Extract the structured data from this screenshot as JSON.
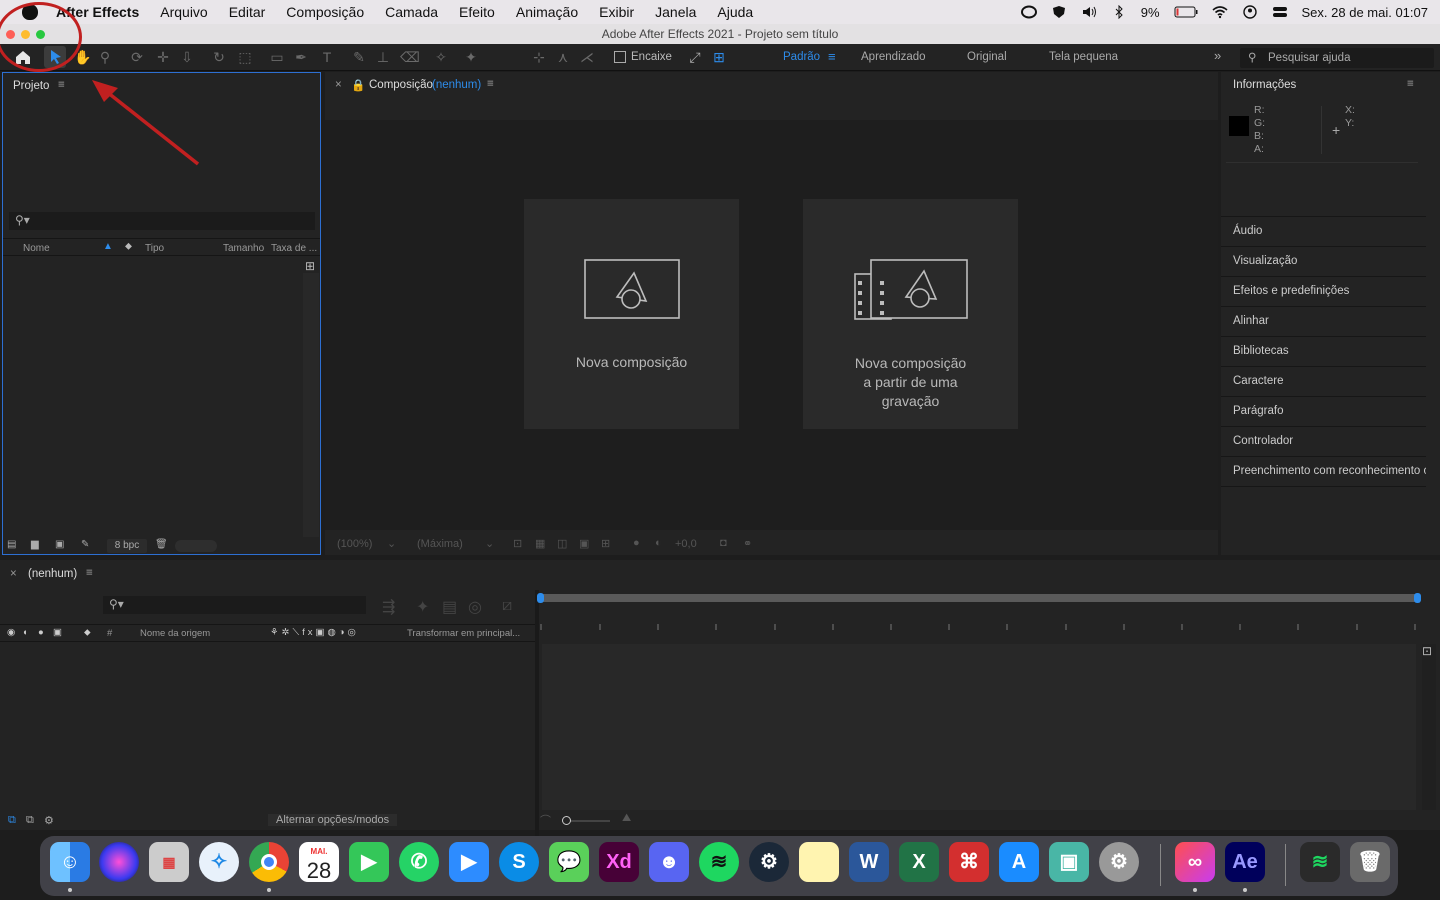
{
  "menubar": {
    "app_name": "After Effects",
    "items": [
      "Arquivo",
      "Editar",
      "Composição",
      "Camada",
      "Efeito",
      "Animação",
      "Exibir",
      "Janela",
      "Ajuda"
    ],
    "battery": "9%",
    "datetime": "Sex. 28 de mai.  01:07"
  },
  "window": {
    "title": "Adobe After Effects 2021 - Projeto sem título"
  },
  "toolbar": {
    "snap_label": "Encaixe",
    "workspaces": [
      "Padrão",
      "Aprendizado",
      "Original",
      "Tela pequena"
    ],
    "active_workspace": "Padrão",
    "help_placeholder": "Pesquisar ajuda"
  },
  "project_panel": {
    "title": "Projeto",
    "columns": [
      "Nome",
      "Tipo",
      "Tamanho",
      "Taxa de ..."
    ],
    "bpc": "8 bpc"
  },
  "composition_panel": {
    "title": "Composição",
    "comp_name": "(nenhum)",
    "new_comp_label": "Nova composição",
    "new_comp_footage_lines": [
      "Nova composição",
      "a partir de uma",
      "gravação"
    ],
    "zoom": "(100%)",
    "resolution": "(Máxima)",
    "exposure": "+0,0"
  },
  "info_panel": {
    "title": "Informações",
    "channels": [
      "R:",
      "G:",
      "B:",
      "A:"
    ],
    "coords": [
      "X:",
      "Y:"
    ],
    "panels": [
      "Áudio",
      "Visualização",
      "Efeitos e predefinições",
      "Alinhar",
      "Bibliotecas",
      "Caractere",
      "Parágrafo",
      "Controlador",
      "Preenchimento com reconhecimento c"
    ]
  },
  "timeline": {
    "comp_name": "(nenhum)",
    "col_source": "Nome da origem",
    "col_parent": "Transformar em principal...",
    "col_hash": "#",
    "toggle_label": "Alternar opções/modos"
  },
  "dock": {
    "calendar_month": "MAI.",
    "calendar_day": "28",
    "apps": [
      "finder-icon",
      "siri-icon",
      "launchpad-icon",
      "safari-icon",
      "chrome-icon",
      "calendar-icon",
      "facetime-icon",
      "whatsapp-icon",
      "zoom-icon",
      "skype-icon",
      "messages-icon",
      "xd-icon",
      "discord-icon",
      "spotify-icon",
      "steam-icon",
      "notes-icon",
      "word-icon",
      "excel-icon",
      "acrobat-icon",
      "appstore-icon",
      "preview-icon",
      "settings-icon",
      "creative-cloud-icon",
      "after-effects-icon",
      "spotify-mini-icon",
      "trash-icon"
    ],
    "xd": "Xd",
    "ae": "Ae",
    "word": "W",
    "excel": "X",
    "skype": "S"
  },
  "colors": {
    "accent_blue": "#2d8ceb",
    "annotation_red": "#c12020"
  }
}
